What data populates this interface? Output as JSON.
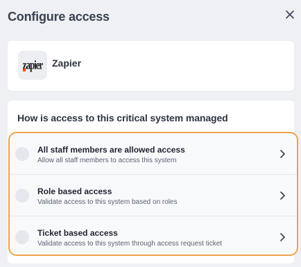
{
  "dialog": {
    "title": "Configure access",
    "close_icon": "close-icon"
  },
  "app": {
    "name": "Zapier",
    "logo_text": "zapier",
    "logo_icon": "zapier-logo"
  },
  "question": {
    "text": "How is access to this critical system managed"
  },
  "options": [
    {
      "title": "All staff members are allowed access",
      "description": "Allow all staff members to access this system",
      "selected": false
    },
    {
      "title": "Role based access",
      "description": "Validate access to this system based on roles",
      "selected": false
    },
    {
      "title": "Ticket based access",
      "description": "Validate access to this system through access request ticket",
      "selected": false
    }
  ],
  "colors": {
    "highlight_border": "#f0a24a",
    "background": "#eef0f4",
    "card": "#ffffff",
    "zapier_orange": "#ff4a00"
  }
}
